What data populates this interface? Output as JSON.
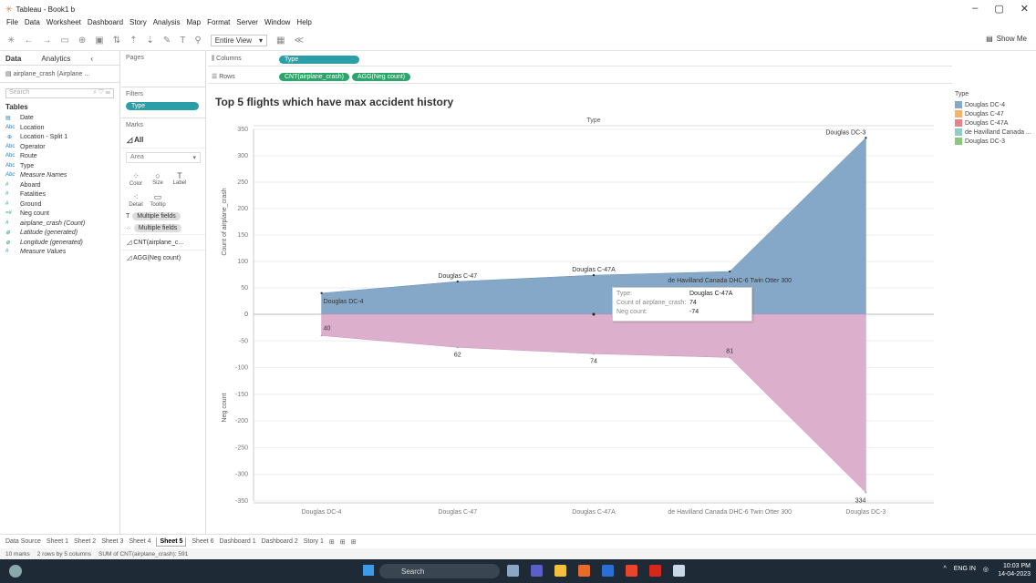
{
  "window": {
    "title": "Tableau - Book1 b",
    "controls": [
      "–",
      "▢",
      "✕"
    ]
  },
  "menu": [
    "File",
    "Data",
    "Worksheet",
    "Dashboard",
    "Story",
    "Analysis",
    "Map",
    "Format",
    "Server",
    "Window",
    "Help"
  ],
  "toolbar": {
    "fit": "Entire View",
    "show_me": "Show Me"
  },
  "data_pane": {
    "tab_data": "Data",
    "tab_analytics": "Analytics",
    "datasource": "airplane_crash (Airplane ...",
    "search_placeholder": "Search",
    "tables_header": "Tables",
    "fields": [
      {
        "icon": "▤",
        "name": "Date",
        "measure": false,
        "italic": false
      },
      {
        "icon": "Abc",
        "name": "Location",
        "measure": false,
        "italic": false
      },
      {
        "icon": "·⊕",
        "name": "Location - Split 1",
        "measure": false,
        "italic": false
      },
      {
        "icon": "Abc",
        "name": "Operator",
        "measure": false,
        "italic": false
      },
      {
        "icon": "Abc",
        "name": "Route",
        "measure": false,
        "italic": false
      },
      {
        "icon": "Abc",
        "name": "Type",
        "measure": false,
        "italic": false
      },
      {
        "icon": "Abc",
        "name": "Measure Names",
        "measure": false,
        "italic": true
      },
      {
        "icon": "#",
        "name": "Aboard",
        "measure": true,
        "italic": false
      },
      {
        "icon": "#",
        "name": "Fatalities",
        "measure": true,
        "italic": false
      },
      {
        "icon": "#",
        "name": "Ground",
        "measure": true,
        "italic": false
      },
      {
        "icon": "=#",
        "name": "Neg count",
        "measure": true,
        "italic": false
      },
      {
        "icon": "#",
        "name": "airplane_crash (Count)",
        "measure": true,
        "italic": true
      },
      {
        "icon": "⊕",
        "name": "Latitude (generated)",
        "measure": true,
        "italic": true
      },
      {
        "icon": "⊕",
        "name": "Longitude (generated)",
        "measure": true,
        "italic": true
      },
      {
        "icon": "#",
        "name": "Measure Values",
        "measure": true,
        "italic": true
      }
    ]
  },
  "shelves": {
    "pages": "Pages",
    "filters": "Filters",
    "filter_pill": "Type",
    "marks": "Marks",
    "marks_all": "All",
    "mark_type": "Area",
    "mark_buttons": [
      "Color",
      "Size",
      "Label",
      "Detail",
      "Tooltip"
    ],
    "mark_fields": [
      "Multiple fields",
      "Multiple fields"
    ],
    "mark_cards": [
      "CNT(airplane_c...",
      "AGG(Neg count)"
    ],
    "columns_label": "Columns",
    "rows_label": "Rows",
    "columns_pill": "Type",
    "rows_pills": [
      "CNT(airplane_crash)",
      "AGG(Neg count)"
    ]
  },
  "viz_title": "Top 5 flights which have max accident history",
  "colors": {
    "blue": "#86a8c8",
    "pink": "#dcafcd",
    "teal": "#2a9fa8",
    "green": "#2ca56a"
  },
  "chart_data": {
    "type": "area",
    "header": "Type",
    "categories": [
      "Douglas DC-4",
      "Douglas C-47",
      "Douglas C-47A",
      "de Havilland Canada DHC-6 Twin Otter 300",
      "Douglas DC-3"
    ],
    "series": [
      {
        "name": "CNT(airplane_crash)",
        "values": [
          40,
          62,
          74,
          81,
          334
        ],
        "ylabel": "Count of airplane_crash",
        "ylim": [
          0,
          350
        ],
        "ticks": [
          0,
          50,
          100,
          150,
          200,
          250,
          300,
          350
        ],
        "labels": [
          "Douglas DC-4",
          "Douglas C-47",
          "Douglas C-47A",
          "de Havilland Canada DHC-6 Twin Otter 300",
          "Douglas DC-3"
        ]
      },
      {
        "name": "AGG(Neg count)",
        "values": [
          -40,
          -62,
          -74,
          -81,
          -334
        ],
        "ylabel": "Neg count",
        "ylim": [
          -350,
          0
        ],
        "ticks": [
          0,
          -50,
          -100,
          -150,
          -200,
          -250,
          -300,
          -350
        ],
        "labels": [
          "40",
          "62",
          "74",
          "81",
          "334"
        ]
      }
    ],
    "grid": true
  },
  "legend": {
    "title": "Type",
    "items": [
      {
        "label": "Douglas DC-4",
        "color": "#86a8c8"
      },
      {
        "label": "Douglas C-47",
        "color": "#f4b26b"
      },
      {
        "label": "Douglas C-47A",
        "color": "#e8828a"
      },
      {
        "label": "de Havilland Canada ...",
        "color": "#8fcdc6"
      },
      {
        "label": "Douglas DC-3",
        "color": "#8cc67a"
      }
    ]
  },
  "tooltip": {
    "rows": [
      {
        "k": "Type:",
        "v": "Douglas C-47A"
      },
      {
        "k": "Count of airplane_crash:",
        "v": "74"
      },
      {
        "k": "Neg count:",
        "v": "-74"
      }
    ]
  },
  "sheet_tabs": [
    "Data Source",
    "Sheet 1",
    "Sheet 2",
    "Sheet 3",
    "Sheet 4",
    "Sheet 5",
    "Sheet 6",
    "Dashboard 1",
    "Dashboard 2",
    "Story 1"
  ],
  "active_tab": "Sheet 5",
  "status": [
    "10 marks",
    "2 rows by 5 columns",
    "SUM of CNT(airplane_crash): 591"
  ],
  "taskbar": {
    "search": "Search",
    "lang": "ENG",
    "region": "IN",
    "time": "10:03 PM",
    "date": "14-04-2023"
  }
}
